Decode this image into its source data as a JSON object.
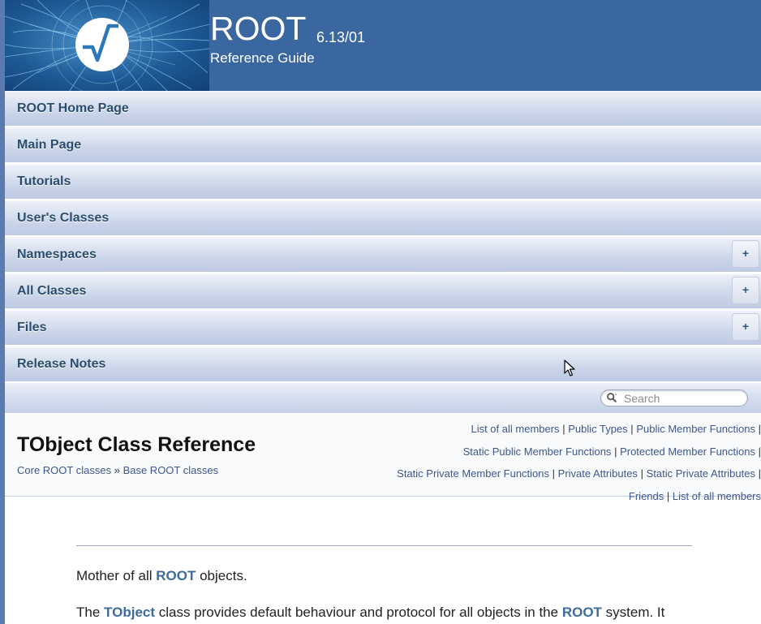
{
  "header": {
    "project_name": "ROOT",
    "project_number": "6.13/01",
    "project_brief": "Reference Guide"
  },
  "nav": {
    "items": [
      {
        "label": "ROOT Home Page",
        "has_submenu": false
      },
      {
        "label": "Main Page",
        "has_submenu": false
      },
      {
        "label": "Tutorials",
        "has_submenu": false
      },
      {
        "label": "User's Classes",
        "has_submenu": false
      },
      {
        "label": "Namespaces",
        "has_submenu": true,
        "toggle": "+"
      },
      {
        "label": "All Classes",
        "has_submenu": true,
        "toggle": "+"
      },
      {
        "label": "Files",
        "has_submenu": true,
        "toggle": "+"
      },
      {
        "label": "Release Notes",
        "has_submenu": false
      }
    ],
    "search_placeholder": "Search"
  },
  "title_area": {
    "title": "TObject Class Reference",
    "breadcrumb": [
      "Core ROOT classes",
      "Base ROOT classes"
    ],
    "breadcrumb_separator": "»",
    "summary_links": [
      "List of all members",
      "Public Types",
      "Public Member Functions",
      "Static Public Member Functions",
      "Protected Member Functions",
      "Static Private Member Functions",
      "Private Attributes",
      "Static Private Attributes",
      "Friends",
      "List of all members"
    ],
    "separator": "|"
  },
  "content": {
    "p1_before": "Mother of all ",
    "p1_link": "ROOT",
    "p1_after": " objects.",
    "p2_before": "The ",
    "p2_link1": "TObject",
    "p2_middle": " class provides default behaviour and protocol for all objects in the ",
    "p2_link2": "ROOT",
    "p2_after": " system. It"
  },
  "colors": {
    "header_bg": "#3a67a0",
    "nav_gradient_top": "#eef1f8",
    "nav_gradient_bottom": "#bfcbe4",
    "link": "#3d578c",
    "nav_text": "#2a4d6e"
  },
  "icons": {
    "logo": "root-logo-icon",
    "search": "magnifier-icon",
    "expand": "plus-icon",
    "cursor": "mouse-pointer-icon"
  }
}
